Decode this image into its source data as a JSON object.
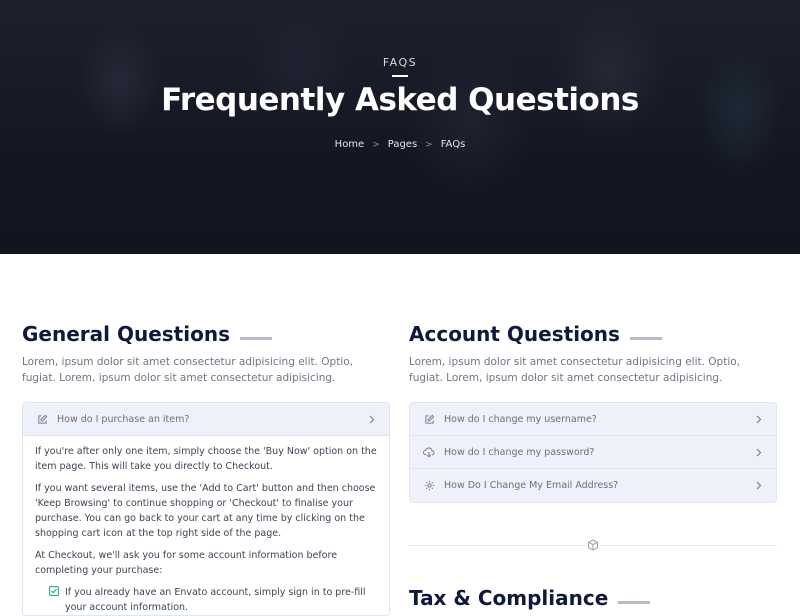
{
  "hero": {
    "eyebrow": "FAQS",
    "title": "Frequently Asked Questions",
    "breadcrumb": [
      "Home",
      "Pages",
      "FAQs"
    ]
  },
  "general": {
    "title": "General Questions",
    "lead": "Lorem, ipsum dolor sit amet consectetur adipisicing elit. Optio, fugiat. Lorem, ipsum dolor sit amet consectetur adipisicing.",
    "question": "How do I purchase an item?",
    "answer": {
      "p1": "If you're after only one item, simply choose the 'Buy Now' option on the item page. This will take you directly to Checkout.",
      "p2": "If you want several items, use the 'Add to Cart' button and then choose 'Keep Browsing' to continue shopping or 'Checkout' to finalise your purchase. You can go back to your cart at any time by clicking on the shopping cart icon at the top right side of the page.",
      "p3": "At Checkout, we'll ask you for some account information before completing your purchase:",
      "check1": "If you already have an Envato account, simply sign in to pre-fill your account information."
    }
  },
  "account": {
    "title": "Account Questions",
    "lead": "Lorem, ipsum dolor sit amet consectetur adipisicing elit. Optio, fugiat. Lorem, ipsum dolor sit amet consectetur adipisicing.",
    "questions": [
      {
        "label": "How do I change my username?",
        "icon": "edit-icon"
      },
      {
        "label": "How do I change my password?",
        "icon": "cloud-download-icon"
      },
      {
        "label": "How Do I Change My Email Address?",
        "icon": "gear-icon"
      }
    ]
  },
  "tax": {
    "title": "Tax & Compliance"
  },
  "colors": {
    "heading": "#0f1a3a",
    "accordion_bg": "#eef0fa",
    "accent_green": "#22b573"
  }
}
